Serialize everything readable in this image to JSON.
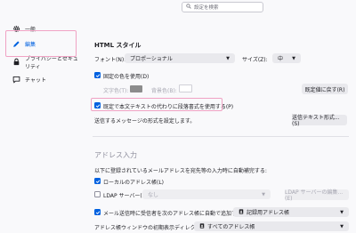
{
  "sidebar": {
    "items": [
      {
        "label": "一般",
        "icon": "gear-icon"
      },
      {
        "label": "編集",
        "icon": "pencil-icon",
        "selected": true
      },
      {
        "label": "プライバシーとセキュリティ",
        "icon": "lock-icon"
      },
      {
        "label": "チャット",
        "icon": "chat-icon"
      }
    ]
  },
  "search": {
    "placeholder": "設定を検索"
  },
  "html_style": {
    "heading": "HTML スタイル",
    "font_label": "フォント(N):",
    "font_value": "プロポーショナル",
    "size_label": "サイズ(Z):",
    "size_value": "中",
    "use_fixed_colors_label": "固定の色を使用(D)",
    "text_color_label": "文字色(T):",
    "text_color": "#8c8c8c",
    "bg_color_label": "背景色(B):",
    "bg_color": "#ffffff",
    "restore_defaults_label": "既定値に戻す(R)",
    "paragraph_style_label": "既定で本文テキストの代わりに段落書式を使用する(P)",
    "send_format_desc": "送信するメッセージの形式を設定します。",
    "send_format_button": "送信テキスト形式...(S)"
  },
  "addressing": {
    "title": "アドレス入力",
    "desc": "以下に登録されているメールアドレスを宛先等の入力時に自動補完する:",
    "local_label": "ローカルのアドレス帳(L)",
    "ldap_label": "LDAP サーバー(D):",
    "ldap_value": "なし",
    "ldap_edit_label": "LDAP サーバーの編集...(E)",
    "auto_add_label": "メール送信時に受信者を次のアドレス帳に自動で追加する(A):",
    "auto_add_value": "記録用アドレス帳",
    "default_dir_label": "アドレス帳ウィンドウの初期表示ディレクトリー(S):",
    "default_dir_value": "すべてのアドレス帳"
  },
  "colors": {
    "accent": "#0061e0",
    "highlight": "#f0a3c4"
  }
}
